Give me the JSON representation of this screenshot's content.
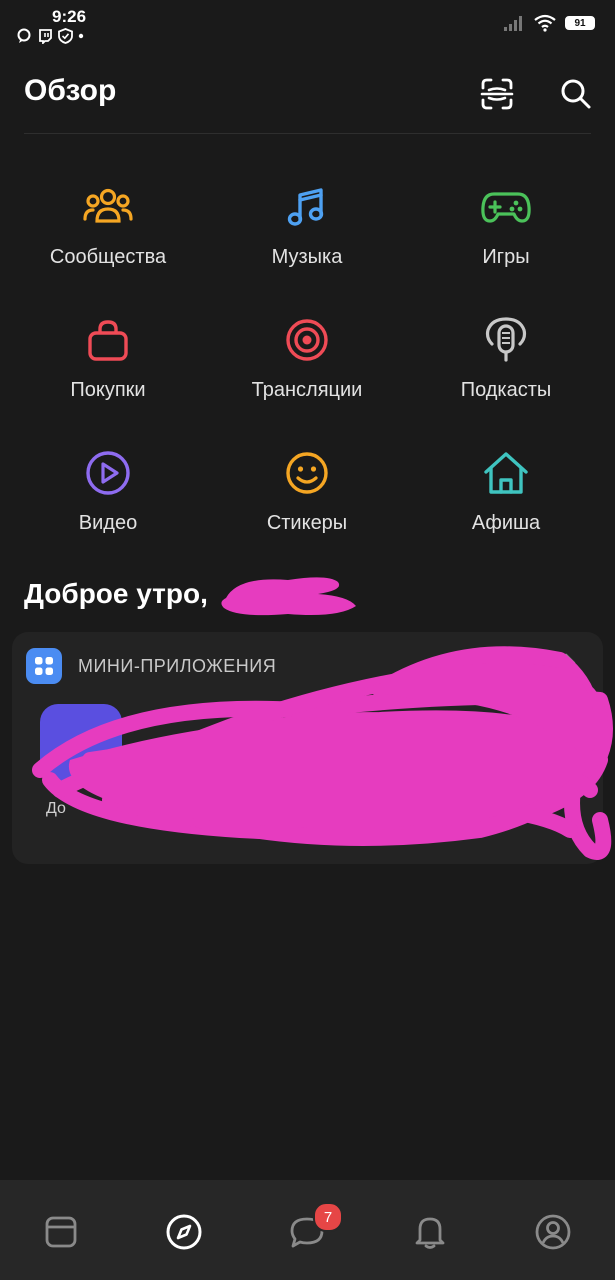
{
  "status_bar": {
    "time": "9:26",
    "battery": "91"
  },
  "header": {
    "title": "Обзор",
    "scan_icon": "scan-icon",
    "search_icon": "search-icon"
  },
  "categories": [
    {
      "label": "Сообщества",
      "icon": "communities-icon",
      "color": "#f5a623"
    },
    {
      "label": "Музыка",
      "icon": "music-icon",
      "color": "#4ea1f2"
    },
    {
      "label": "Игры",
      "icon": "gamepad-icon",
      "color": "#4bc25a"
    },
    {
      "label": "Покупки",
      "icon": "shopping-bag-icon",
      "color": "#ef4b56"
    },
    {
      "label": "Трансляции",
      "icon": "broadcast-icon",
      "color": "#ef4b56"
    },
    {
      "label": "Подкасты",
      "icon": "podcast-icon",
      "color": "#c8c8c8"
    },
    {
      "label": "Видео",
      "icon": "video-icon",
      "color": "#8e6cf0"
    },
    {
      "label": "Стикеры",
      "icon": "sticker-icon",
      "color": "#f5a623"
    },
    {
      "label": "Афиша",
      "icon": "home-icon",
      "color": "#3fc4c0"
    }
  ],
  "greeting": "Доброе утро,",
  "mini_apps": {
    "title": "МИНИ-ПРИЛОЖЕНИЯ",
    "first_app_label": "До"
  },
  "bottom_nav": [
    {
      "icon": "feed-icon"
    },
    {
      "icon": "explore-icon",
      "active": true
    },
    {
      "icon": "messages-icon",
      "badge": "7"
    },
    {
      "icon": "notifications-icon"
    },
    {
      "icon": "profile-icon"
    }
  ],
  "colors": {
    "background": "#1a1a1a",
    "scribble": "#e63cbf",
    "badge": "#e64646"
  }
}
